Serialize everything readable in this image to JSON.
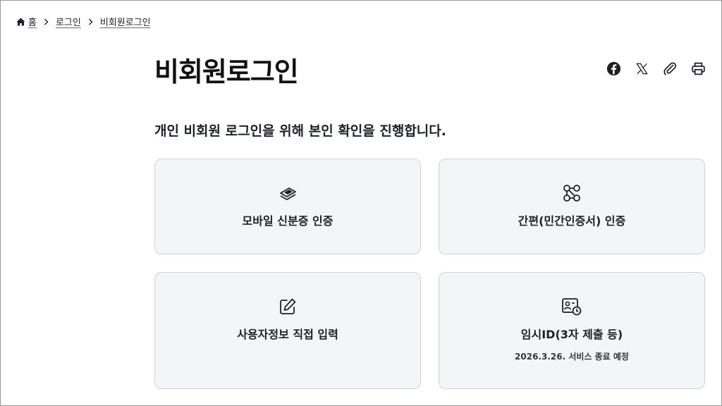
{
  "breadcrumb": {
    "home": "홈",
    "items": [
      "로그인",
      "비회원로그인"
    ]
  },
  "page": {
    "title": "비회원로그인",
    "intro": "개인 비회원 로그인을 위해 본인 확인을 진행합니다."
  },
  "share": {
    "icons": [
      "facebook-icon",
      "x-icon",
      "link-icon",
      "print-icon"
    ]
  },
  "cards": [
    {
      "icon": "mobile-id-icon",
      "label": "모바일 신분증 인증"
    },
    {
      "icon": "simple-auth-icon",
      "label": "간편(민간인증서) 인증"
    },
    {
      "icon": "edit-icon",
      "label": "사용자정보 직접 입력"
    },
    {
      "icon": "temp-id-icon",
      "label": "임시ID(3자 제출 등)",
      "note": "2026.3.26. 서비스 종료 예정"
    }
  ],
  "colors": {
    "card_bg": "#f4f5f6",
    "card_border": "#cfd2d6",
    "text": "#1e2124"
  }
}
